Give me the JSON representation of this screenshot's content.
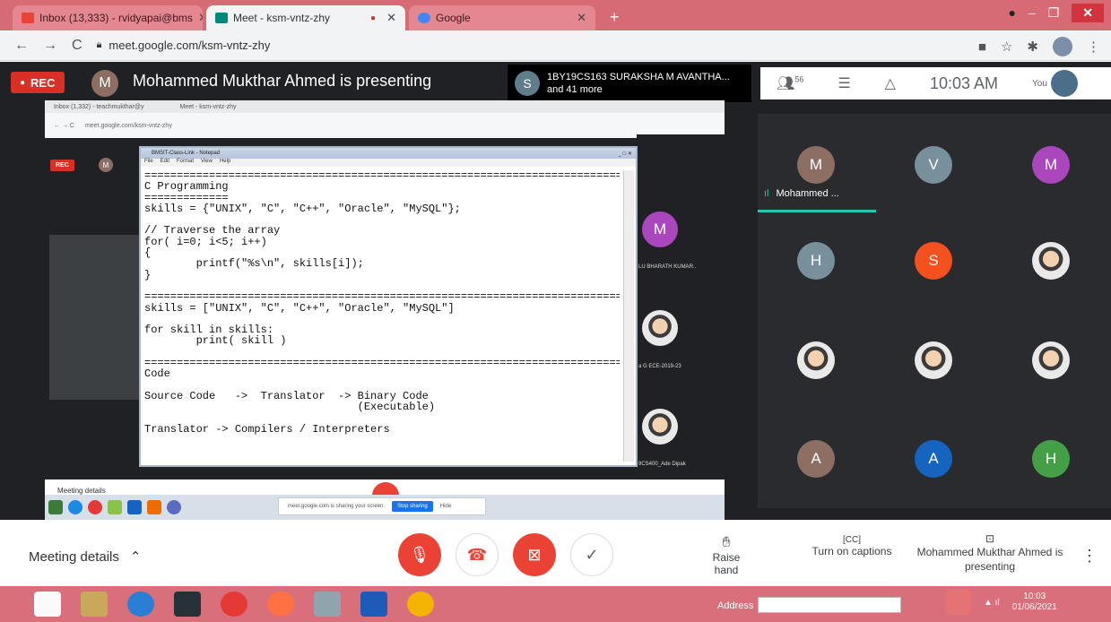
{
  "browser": {
    "tabs": [
      {
        "label": "Inbox (13,333) - rvidyapai@bms",
        "active": false
      },
      {
        "label": "Meet - ksm-vntz-zhy",
        "active": true
      },
      {
        "label": "Google",
        "active": false
      }
    ],
    "url": "meet.google.com/ksm-vntz-zhy"
  },
  "meet": {
    "rec_label": "REC",
    "presenter_initial": "M",
    "presenter_text": "Mohammed Mukthar Ahmed is presenting",
    "pinned": {
      "initial": "S",
      "name": "1BY19CS163 SURAKSHA M AVANTHA...",
      "more": "and 41 more"
    },
    "participants_count": "56",
    "time": "10:03 AM",
    "you_label": "You",
    "speaking_name": "Mohammed ...",
    "grid": [
      {
        "initial": "M",
        "color": "#8d6e63"
      },
      {
        "initial": "V",
        "color": "#78909c"
      },
      {
        "initial": "M",
        "color": "#ab47bc"
      },
      {
        "initial": "H",
        "color": "#78909c"
      },
      {
        "initial": "S",
        "color": "#f4511e"
      },
      {
        "initial": "",
        "color": "photo"
      },
      {
        "initial": "",
        "color": "photo"
      },
      {
        "initial": "",
        "color": "photo"
      },
      {
        "initial": "",
        "color": "photo"
      },
      {
        "initial": "A",
        "color": "#8d6e63"
      },
      {
        "initial": "A",
        "color": "#1565c0"
      },
      {
        "initial": "H",
        "color": "#43a047"
      }
    ]
  },
  "shared_screen": {
    "inner_tab1": "Inbox (1,332) - teachmukthar@y",
    "inner_tab2": "Meet - ksm-vntz-zhy",
    "inner_url": "meet.google.com/ksm-vntz-zhy",
    "inner_rec": "REC",
    "side_labels": [
      "LU BHARATH KUMAR..",
      "a G ECE-2019-23",
      "9CS400_Ade Dipak"
    ],
    "side_avatar_initial": "M",
    "bottom_text": "Meeting details",
    "sharing_text": "meet.google.com is sharing your screen.",
    "stop_sharing": "Stop sharing",
    "hide": "Hide",
    "notepad_title": "BMSIT-Class-Link - Notepad",
    "notepad_menu": [
      "File",
      "Edit",
      "Format",
      "View",
      "Help"
    ],
    "notepad_text": "============================================================================\nC Programming\n=============\nskills = {\"UNIX\", \"C\", \"C++\", \"Oracle\", \"MySQL\"};\n\n// Traverse the array\nfor( i=0; i<5; i++)\n{\n        printf(\"%s\\n\", skills[i]);\n}\n\n============================================================================\nskills = [\"UNIX\", \"C\", \"C++\", \"Oracle\", \"MySQL\"]\n\nfor skill in skills:\n        print( skill )\n\n============================================================================\nCode\n\nSource Code   ->  Translator  -> Binary Code\n                                 (Executable)\n\nTranslator -> Compilers / Interpreters"
  },
  "controls": {
    "meeting_details": "Meeting details",
    "raise_hand": "Raise hand",
    "captions": "Turn on captions",
    "presenting": "Mohammed Mukthar Ahmed is presenting"
  },
  "taskbar": {
    "address_label": "Address",
    "clock_time": "10:03",
    "clock_date": "01/06/2021"
  }
}
